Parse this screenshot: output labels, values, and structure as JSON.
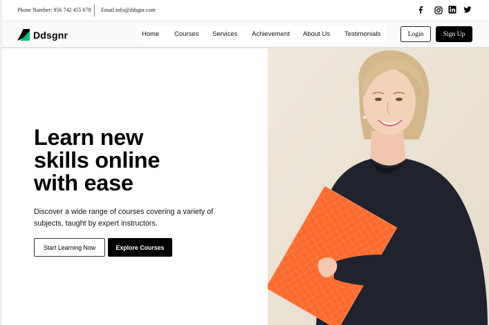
{
  "topbar": {
    "phone": "Phone Number: 956 742 455 678",
    "email": "Email:info@ddsgnr.com",
    "social": [
      "facebook-icon",
      "instagram-icon",
      "linkedin-icon",
      "twitter-icon"
    ]
  },
  "nav": {
    "brand": "Ddsgnr",
    "links": [
      "Home",
      "Courses",
      "Services",
      "Achievement",
      "About Us",
      "Testimonials"
    ],
    "login": "Login",
    "signup": "Sign Up"
  },
  "hero": {
    "title_lines": [
      "Learn new",
      "skills online",
      "with ease"
    ],
    "subtitle": "Discover a wide range of courses covering a variety of subjects, taught by expert instructors.",
    "primary_button": "Start Learning Now",
    "secondary_button": "Explore Courses",
    "image_subject": "smiling woman holding an orange folder"
  },
  "colors": {
    "accent_green": "#00c27a",
    "dark": "#000000",
    "folder_orange": "#ff6a2e",
    "photo_background": "#ece3d4"
  }
}
